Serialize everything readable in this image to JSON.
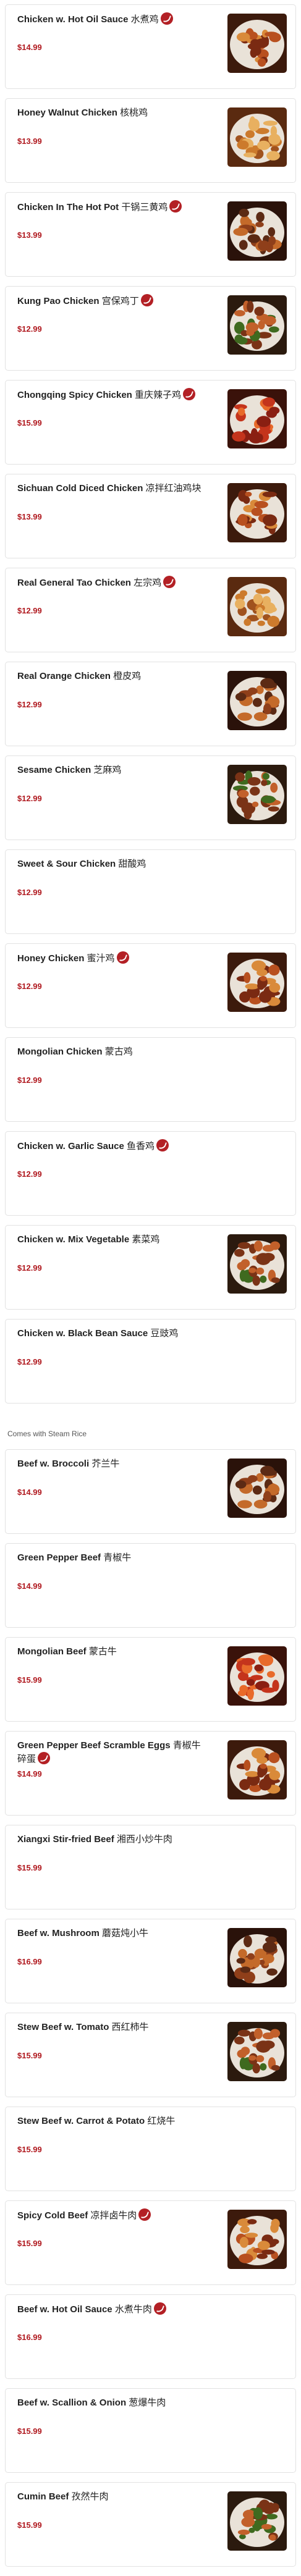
{
  "colors": {
    "price": "#b0191f",
    "spicy_badge": "#b32025",
    "card_border": "#e2e2e2"
  },
  "chicken_section": {
    "items": [
      {
        "name": "Chicken w. Hot Oil Sauce",
        "cn": "水煮鸡",
        "price": "$14.99",
        "spicy": true,
        "photo": "chicken-hot-oil-photo"
      },
      {
        "name": "Honey Walnut Chicken",
        "cn": "核桃鸡",
        "price": "$13.99",
        "spicy": false,
        "photo": "honey-walnut-chicken-photo"
      },
      {
        "name": "Chicken In The Hot Pot",
        "cn": "干锅三黄鸡",
        "price": "$13.99",
        "spicy": true,
        "photo": "hot-pot-chicken-photo"
      },
      {
        "name": "Kung Pao Chicken",
        "cn": "宫保鸡丁",
        "price": "$12.99",
        "spicy": true,
        "photo": "kung-pao-chicken-photo"
      },
      {
        "name": "Chongqing Spicy Chicken",
        "cn": "重庆辣子鸡",
        "price": "$15.99",
        "spicy": true,
        "photo": "chongqing-chicken-photo"
      },
      {
        "name": "Sichuan Cold Diced Chicken",
        "cn": "凉拌红油鸡块",
        "price": "$13.99",
        "spicy": false,
        "photo": "sichuan-cold-chicken-photo"
      },
      {
        "name": "Real General Tao Chicken",
        "cn": "左宗鸡",
        "price": "$12.99",
        "spicy": true,
        "photo": "general-tao-chicken-photo"
      },
      {
        "name": "Real Orange Chicken",
        "cn": "橙皮鸡",
        "price": "$12.99",
        "spicy": false,
        "photo": "orange-chicken-photo"
      },
      {
        "name": "Sesame Chicken",
        "cn": "芝麻鸡",
        "price": "$12.99",
        "spicy": false,
        "photo": "sesame-chicken-photo"
      },
      {
        "name": "Sweet & Sour Chicken",
        "cn": "甜酸鸡",
        "price": "$12.99",
        "spicy": false,
        "photo": null
      },
      {
        "name": "Honey Chicken",
        "cn": "蜜汁鸡",
        "price": "$12.99",
        "spicy": true,
        "photo": "honey-chicken-photo"
      },
      {
        "name": "Mongolian Chicken",
        "cn": "蒙古鸡",
        "price": "$12.99",
        "spicy": false,
        "photo": null
      },
      {
        "name": "Chicken w. Garlic Sauce",
        "cn": "鱼香鸡",
        "price": "$12.99",
        "spicy": true,
        "photo": null
      },
      {
        "name": "Chicken w. Mix Vegetable",
        "cn": "素菜鸡",
        "price": "$12.99",
        "spicy": false,
        "photo": "mix-vegetable-chicken-photo"
      },
      {
        "name": "Chicken w. Black Bean Sauce",
        "cn": "豆豉鸡",
        "price": "$12.99",
        "spicy": false,
        "photo": null
      }
    ]
  },
  "beef_section": {
    "note": "Comes with Steam Rice",
    "items": [
      {
        "name": "Beef w. Broccoli",
        "cn": "芥兰牛",
        "price": "$14.99",
        "spicy": false,
        "photo": "beef-broccoli-photo"
      },
      {
        "name": "Green Pepper Beef",
        "cn": "青椒牛",
        "price": "$14.99",
        "spicy": false,
        "photo": null
      },
      {
        "name": "Mongolian Beef",
        "cn": "蒙古牛",
        "price": "$15.99",
        "spicy": false,
        "photo": "mongolian-beef-photo"
      },
      {
        "name": "Green Pepper Beef Scramble Eggs",
        "cn": "青椒牛碎蛋",
        "price": "$14.99",
        "spicy": true,
        "photo": "pepper-beef-eggs-photo"
      },
      {
        "name": "Xiangxi Stir-fried Beef",
        "cn": "湘西小炒牛肉",
        "price": "$15.99",
        "spicy": false,
        "photo": null
      },
      {
        "name": "Beef w. Mushroom",
        "cn": "蘑菇炖小牛",
        "price": "$16.99",
        "spicy": false,
        "photo": "beef-mushroom-photo"
      },
      {
        "name": "Stew Beef w. Tomato",
        "cn": "西红柿牛",
        "price": "$15.99",
        "spicy": false,
        "photo": "stew-beef-tomato-photo"
      },
      {
        "name": "Stew Beef w. Carrot & Potato",
        "cn": "红烧牛",
        "price": "$15.99",
        "spicy": false,
        "photo": null
      },
      {
        "name": "Spicy Cold Beef",
        "cn": "凉拌卤牛肉",
        "price": "$15.99",
        "spicy": true,
        "photo": "spicy-cold-beef-photo"
      },
      {
        "name": "Beef w. Hot Oil Sauce",
        "cn": "水煮牛肉",
        "price": "$16.99",
        "spicy": true,
        "photo": null
      },
      {
        "name": "Beef w. Scallion & Onion",
        "cn": "葱爆牛肉",
        "price": "$15.99",
        "spicy": false,
        "photo": null
      },
      {
        "name": "Cumin Beef",
        "cn": "孜然牛肉",
        "price": "$15.99",
        "spicy": false,
        "photo": "cumin-beef-photo"
      }
    ]
  }
}
